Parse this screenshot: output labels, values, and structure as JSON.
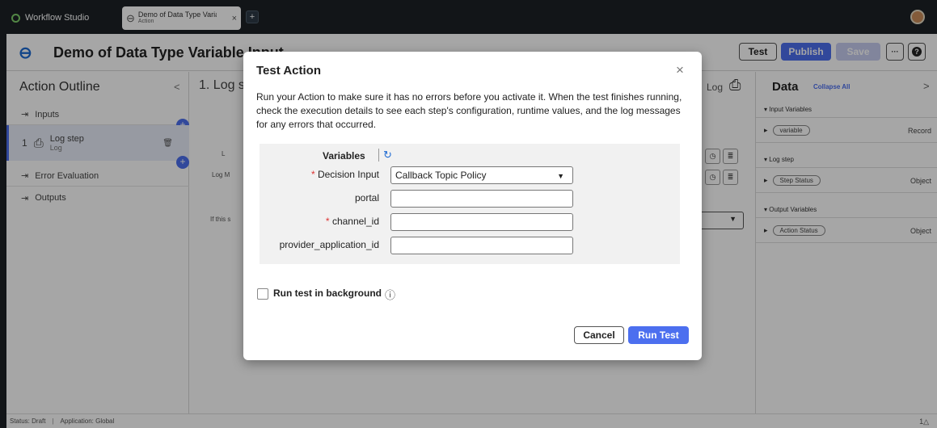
{
  "topbar": {
    "app_label": "Workflow Studio",
    "tab_title": "Demo of Data Type Varia",
    "tab_subtitle": "Action",
    "tab_close": "×",
    "tab_add": "+"
  },
  "header": {
    "title": "Demo of Data Type Variable Input",
    "buttons": {
      "test": "Test",
      "publish": "Publish",
      "save": "Save",
      "more": "···",
      "help": "?"
    }
  },
  "outline": {
    "title": "Action Outline",
    "collapse": "<",
    "items": [
      {
        "label": "Inputs"
      },
      {
        "num": "1",
        "label": "Log step",
        "sub": "Log"
      },
      {
        "label": "Error Evaluation"
      },
      {
        "label": "Outputs"
      }
    ]
  },
  "center": {
    "step_title": "1. Log s",
    "label_1": "L",
    "label_2": "Log M",
    "label_3": "If this s",
    "log_label": "Log"
  },
  "data_panel": {
    "title": "Data",
    "collapse_all": "Collapse All",
    "chevron": ">",
    "sections": [
      {
        "label": "Input Variables",
        "rows": [
          {
            "pill": "variable",
            "type": "Record"
          }
        ]
      },
      {
        "label": "Log step",
        "rows": [
          {
            "pill": "Step Status",
            "type": "Object"
          }
        ]
      },
      {
        "label": "Output Variables",
        "rows": [
          {
            "pill": "Action Status",
            "type": "Object"
          }
        ]
      }
    ]
  },
  "statusbar": {
    "status": "Status: Draft",
    "application": "Application: Global",
    "right": "1△"
  },
  "modal": {
    "title": "Test Action",
    "close": "×",
    "description": "Run your Action to make sure it has no errors before you activate it. When the test finishes running, check the execution details to see each step's configuration, runtime values, and the log messages for any errors that occurred.",
    "variables_label": "Variables",
    "fields": [
      {
        "label": "Decision Input",
        "required": true,
        "value": "Callback Topic Policy"
      },
      {
        "label": "portal",
        "required": false,
        "value": ""
      },
      {
        "label": "channel_id",
        "required": true,
        "value": ""
      },
      {
        "label": "provider_application_id",
        "required": false,
        "value": ""
      }
    ],
    "background_label": "Run test in background",
    "cancel": "Cancel",
    "run": "Run Test"
  }
}
